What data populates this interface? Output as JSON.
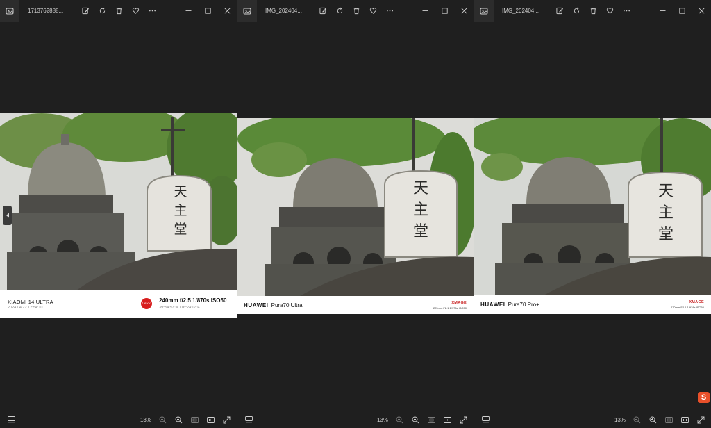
{
  "windows": [
    {
      "title": "1713762888...",
      "caption": {
        "brand": "XIAOMI 14 ULTRA",
        "datetime": "2024.04.22  12:54:10",
        "logo_text": "Leica",
        "exif": "240mm  f/2.5  1/870s  ISO50",
        "gps": "39°54'57\"N  116°24'17\"E"
      },
      "zoom": "13%"
    },
    {
      "title": "IMG_202404...",
      "caption": {
        "brand_bold": "HUAWEI",
        "model": "Pura70 Ultra",
        "xmage": "XMAGE",
        "exif": "270mm  F2.1  1/976s  ISO50"
      },
      "zoom": "13%"
    },
    {
      "title": "IMG_202404...",
      "caption": {
        "brand_bold": "HUAWEI",
        "model": "Pura70 Pro+",
        "xmage": "XMAGE",
        "exif": "270mm  F2.1  1/928s  ISO50"
      },
      "zoom": "13%"
    }
  ],
  "photo_sign_text": "天主堂",
  "icons": {
    "app": "photos-app-icon",
    "edit": "edit-image-icon",
    "rotate": "rotate-icon",
    "delete": "trash-icon",
    "favorite": "heart-icon",
    "more": "more-icon",
    "minimize": "minimize-icon",
    "maximize": "maximize-icon",
    "close": "close-icon",
    "filmstrip": "filmstrip-icon",
    "zoom_out": "zoom-out-icon",
    "zoom_in": "zoom-in-icon",
    "fit": "fit-to-window-icon",
    "actual_size": "actual-size-icon",
    "fullscreen": "fullscreen-icon",
    "previous": "previous-image-icon"
  },
  "tray_badge": "S",
  "colors": {
    "window_bg": "#1f1f1f",
    "caption_bg": "#ffffff",
    "leica_red": "#d81e1e",
    "xmage_red": "#c82020",
    "sky": "#d9dad6",
    "foliage": "#5f8a3a",
    "stone": "#5a5a55"
  }
}
